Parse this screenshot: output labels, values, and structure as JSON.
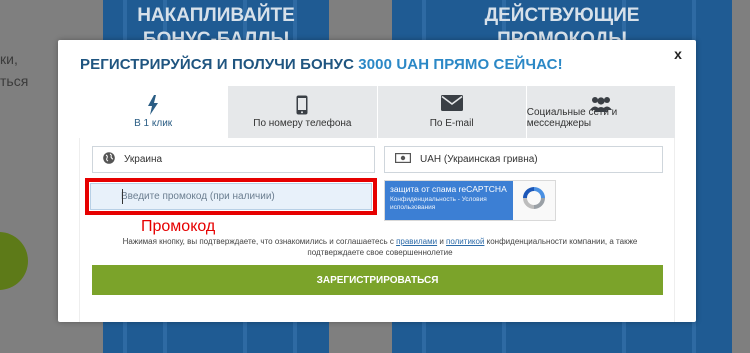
{
  "background": {
    "left_text_lines": [
      "ки,",
      "ться"
    ],
    "banner_1_lines": [
      "НАКАПЛИВАЙТЕ",
      "БОНУС-БАЛЛЫ"
    ],
    "banner_2_lines": [
      "ДЕЙСТВУЮЩИЕ",
      "ПРОМОКОДЫ"
    ]
  },
  "modal": {
    "title_main": "РЕГИСТРИРУЙСЯ И ПОЛУЧИ БОНУС",
    "title_accent": "3000 UAH ПРЯМО СЕЙЧАС!",
    "close_label": "x"
  },
  "tabs": [
    {
      "label": "В 1 клик",
      "icon": "lightning-icon",
      "active": true
    },
    {
      "label": "По номеру телефона",
      "icon": "phone-icon",
      "active": false
    },
    {
      "label": "По E-mail",
      "icon": "envelope-icon",
      "active": false
    },
    {
      "label": "Социальные сети и мессенджеры",
      "icon": "users-icon",
      "active": false
    }
  ],
  "form": {
    "country_value": "Украина",
    "currency_value": "UAH (Украинская гривна)",
    "promo_placeholder": "Введите промокод (при наличии)",
    "promo_value": "",
    "captcha_title": "защита от спама reCAPTCHA",
    "captcha_sub": "Конфиденциальность - Условия использования",
    "promo_annotation": "Промокод",
    "agreement_part1": "Нажимая кнопку, вы подтверждаете, что ознакомились и соглашаетесь с ",
    "agreement_link1": "правилами",
    "agreement_part2": " и ",
    "agreement_link2": "политикой",
    "agreement_part3": " конфиденциальности компании, а также подтверждаете свое совершеннолетие",
    "submit_label": "ЗАРЕГИСТРИРОВАТЬСЯ"
  },
  "colors": {
    "accent_blue": "#2b88c6",
    "title_blue": "#1f5580",
    "submit_green": "#7ba32a",
    "highlight_red": "#e60000"
  }
}
